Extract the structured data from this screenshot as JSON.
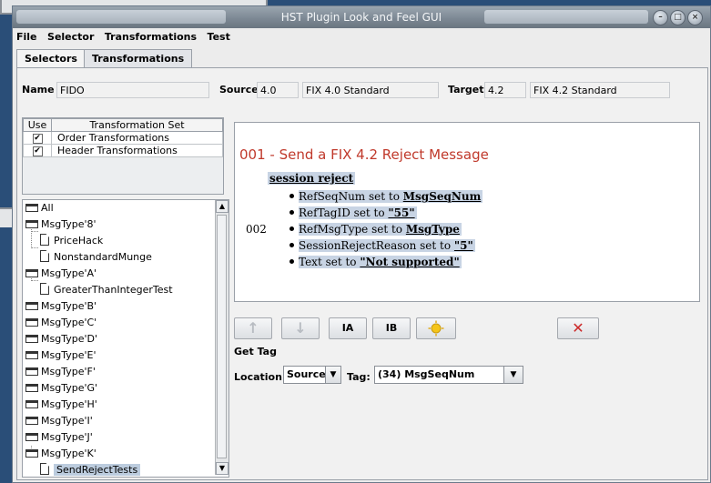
{
  "window": {
    "title": "HST Plugin Look and Feel GUI"
  },
  "menu": [
    "File",
    "Selector",
    "Transformations",
    "Test"
  ],
  "tabs": [
    "Selectors",
    "Transformations"
  ],
  "name": {
    "label": "Name",
    "value": "FIDO"
  },
  "source": {
    "label": "Source",
    "version": "4.0",
    "desc": "FIX 4.0 Standard"
  },
  "target": {
    "label": "Target",
    "version": "4.2",
    "desc": "FIX 4.2 Standard"
  },
  "transformation_sets": {
    "headers": [
      "Use",
      "Transformation Set"
    ],
    "rows": [
      {
        "checked": true,
        "name": "Order Transformations"
      },
      {
        "checked": true,
        "name": "Header Transformations"
      }
    ]
  },
  "tree": [
    {
      "label": "All",
      "type": "folder",
      "level": 0
    },
    {
      "label": "MsgType'8'",
      "type": "folder",
      "level": 0
    },
    {
      "label": "PriceHack",
      "type": "doc",
      "level": 1
    },
    {
      "label": "NonstandardMunge",
      "type": "doc",
      "level": 1
    },
    {
      "label": "MsgType'A'",
      "type": "folder",
      "level": 0
    },
    {
      "label": "GreaterThanIntegerTest",
      "type": "doc",
      "level": 1
    },
    {
      "label": "MsgType'B'",
      "type": "folder",
      "level": 0
    },
    {
      "label": "MsgType'C'",
      "type": "folder",
      "level": 0
    },
    {
      "label": "MsgType'D'",
      "type": "folder",
      "level": 0
    },
    {
      "label": "MsgType'E'",
      "type": "folder",
      "level": 0
    },
    {
      "label": "MsgType'F'",
      "type": "folder",
      "level": 0
    },
    {
      "label": "MsgType'G'",
      "type": "folder",
      "level": 0
    },
    {
      "label": "MsgType'H'",
      "type": "folder",
      "level": 0
    },
    {
      "label": "MsgType'I'",
      "type": "folder",
      "level": 0
    },
    {
      "label": "MsgType'J'",
      "type": "folder",
      "level": 0
    },
    {
      "label": "MsgType'K'",
      "type": "folder",
      "level": 0
    },
    {
      "label": "SendRejectTests",
      "type": "doc",
      "level": 1,
      "selected": true
    }
  ],
  "view": {
    "heading": "001 - Send a FIX 4.2 Reject Message",
    "subheading": "session reject",
    "step_number": "002",
    "items": [
      {
        "text": "RefSeqNum set to ",
        "value": "MsgSeqNum"
      },
      {
        "text": "RefTagID set to ",
        "value": "\"55\""
      },
      {
        "text": "RefMsgType set to ",
        "value": "MsgType"
      },
      {
        "text": "SessionRejectReason set to ",
        "value": "\"5\""
      },
      {
        "text": "Text set to ",
        "value": "\"Not supported\""
      }
    ]
  },
  "toolbar": {
    "up": "↑",
    "down": "↓",
    "ia": "IA",
    "ib": "IB",
    "delete": "✕"
  },
  "get_tag": {
    "heading": "Get Tag",
    "location_label": "Location:",
    "location_value": "Source",
    "tag_label": "Tag:",
    "tag_value": "(34) MsgSeqNum"
  },
  "colors": {
    "titlebar": "#7d8994",
    "heading_red": "#c0392b",
    "selection": "#bcccde",
    "delete_red": "#cc2a2a"
  }
}
